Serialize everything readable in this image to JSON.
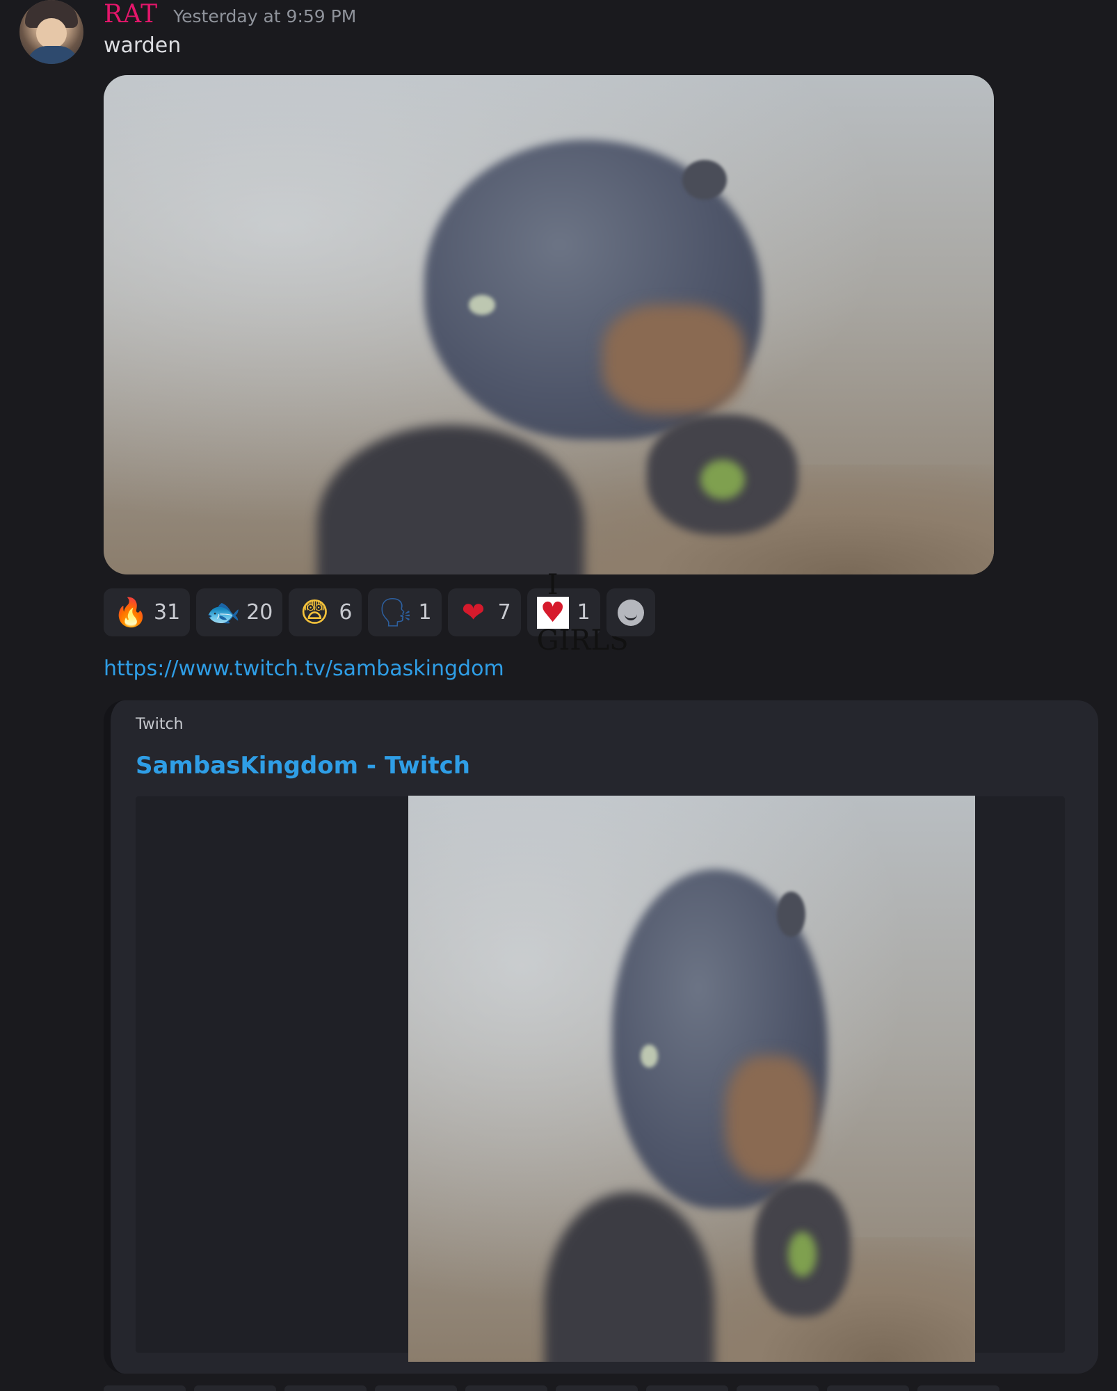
{
  "message": {
    "username": "RAT",
    "timestamp": "Yesterday at 9:59 PM",
    "text": "warden",
    "username_color": "#e5166b"
  },
  "reactions": [
    {
      "emoji": "fire-icon",
      "glyph": "🔥",
      "count": "31"
    },
    {
      "emoji": "fish-icon",
      "glyph": "🐟",
      "count": "20"
    },
    {
      "emoji": "anxious-face-icon",
      "glyph": "😨",
      "count": "6"
    },
    {
      "emoji": "speaking-head-icon",
      "glyph": "🗣",
      "count": "1"
    },
    {
      "emoji": "heart-icon",
      "glyph": "❤",
      "count": "7"
    },
    {
      "emoji": "i-love-girls-icon",
      "badge_line1": "I",
      "badge_heart": "♥",
      "badge_line2": "GIRLS",
      "count": "1"
    }
  ],
  "link": {
    "url": "https://www.twitch.tv/sambaskingdom"
  },
  "embed": {
    "provider": "Twitch",
    "title": "SambasKingdom - Twitch",
    "accent_color": "#2f9ee6"
  }
}
